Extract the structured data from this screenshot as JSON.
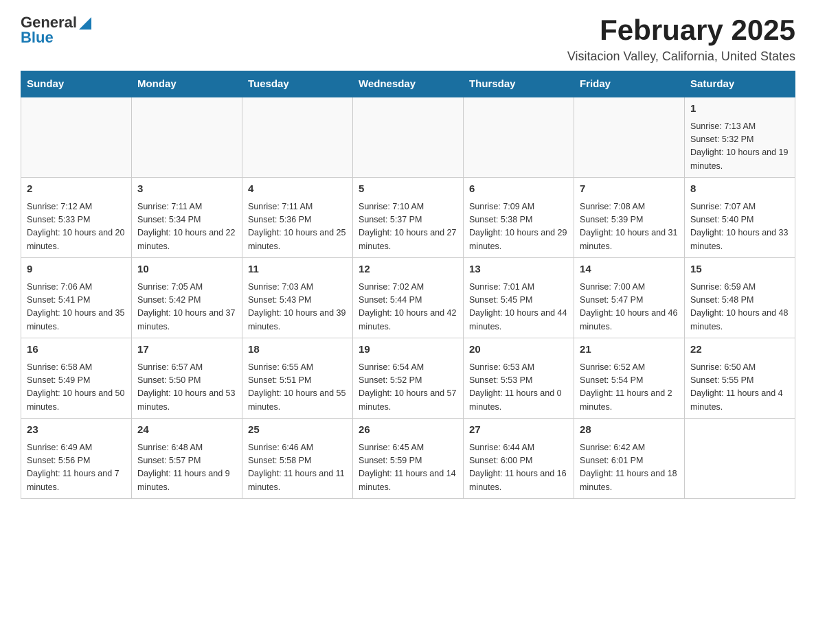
{
  "header": {
    "logo_general": "General",
    "logo_blue": "Blue",
    "month_title": "February 2025",
    "location": "Visitacion Valley, California, United States"
  },
  "calendar": {
    "days_of_week": [
      "Sunday",
      "Monday",
      "Tuesday",
      "Wednesday",
      "Thursday",
      "Friday",
      "Saturday"
    ],
    "weeks": [
      [
        {
          "day": "",
          "info": ""
        },
        {
          "day": "",
          "info": ""
        },
        {
          "day": "",
          "info": ""
        },
        {
          "day": "",
          "info": ""
        },
        {
          "day": "",
          "info": ""
        },
        {
          "day": "",
          "info": ""
        },
        {
          "day": "1",
          "info": "Sunrise: 7:13 AM\nSunset: 5:32 PM\nDaylight: 10 hours and 19 minutes."
        }
      ],
      [
        {
          "day": "2",
          "info": "Sunrise: 7:12 AM\nSunset: 5:33 PM\nDaylight: 10 hours and 20 minutes."
        },
        {
          "day": "3",
          "info": "Sunrise: 7:11 AM\nSunset: 5:34 PM\nDaylight: 10 hours and 22 minutes."
        },
        {
          "day": "4",
          "info": "Sunrise: 7:11 AM\nSunset: 5:36 PM\nDaylight: 10 hours and 25 minutes."
        },
        {
          "day": "5",
          "info": "Sunrise: 7:10 AM\nSunset: 5:37 PM\nDaylight: 10 hours and 27 minutes."
        },
        {
          "day": "6",
          "info": "Sunrise: 7:09 AM\nSunset: 5:38 PM\nDaylight: 10 hours and 29 minutes."
        },
        {
          "day": "7",
          "info": "Sunrise: 7:08 AM\nSunset: 5:39 PM\nDaylight: 10 hours and 31 minutes."
        },
        {
          "day": "8",
          "info": "Sunrise: 7:07 AM\nSunset: 5:40 PM\nDaylight: 10 hours and 33 minutes."
        }
      ],
      [
        {
          "day": "9",
          "info": "Sunrise: 7:06 AM\nSunset: 5:41 PM\nDaylight: 10 hours and 35 minutes."
        },
        {
          "day": "10",
          "info": "Sunrise: 7:05 AM\nSunset: 5:42 PM\nDaylight: 10 hours and 37 minutes."
        },
        {
          "day": "11",
          "info": "Sunrise: 7:03 AM\nSunset: 5:43 PM\nDaylight: 10 hours and 39 minutes."
        },
        {
          "day": "12",
          "info": "Sunrise: 7:02 AM\nSunset: 5:44 PM\nDaylight: 10 hours and 42 minutes."
        },
        {
          "day": "13",
          "info": "Sunrise: 7:01 AM\nSunset: 5:45 PM\nDaylight: 10 hours and 44 minutes."
        },
        {
          "day": "14",
          "info": "Sunrise: 7:00 AM\nSunset: 5:47 PM\nDaylight: 10 hours and 46 minutes."
        },
        {
          "day": "15",
          "info": "Sunrise: 6:59 AM\nSunset: 5:48 PM\nDaylight: 10 hours and 48 minutes."
        }
      ],
      [
        {
          "day": "16",
          "info": "Sunrise: 6:58 AM\nSunset: 5:49 PM\nDaylight: 10 hours and 50 minutes."
        },
        {
          "day": "17",
          "info": "Sunrise: 6:57 AM\nSunset: 5:50 PM\nDaylight: 10 hours and 53 minutes."
        },
        {
          "day": "18",
          "info": "Sunrise: 6:55 AM\nSunset: 5:51 PM\nDaylight: 10 hours and 55 minutes."
        },
        {
          "day": "19",
          "info": "Sunrise: 6:54 AM\nSunset: 5:52 PM\nDaylight: 10 hours and 57 minutes."
        },
        {
          "day": "20",
          "info": "Sunrise: 6:53 AM\nSunset: 5:53 PM\nDaylight: 11 hours and 0 minutes."
        },
        {
          "day": "21",
          "info": "Sunrise: 6:52 AM\nSunset: 5:54 PM\nDaylight: 11 hours and 2 minutes."
        },
        {
          "day": "22",
          "info": "Sunrise: 6:50 AM\nSunset: 5:55 PM\nDaylight: 11 hours and 4 minutes."
        }
      ],
      [
        {
          "day": "23",
          "info": "Sunrise: 6:49 AM\nSunset: 5:56 PM\nDaylight: 11 hours and 7 minutes."
        },
        {
          "day": "24",
          "info": "Sunrise: 6:48 AM\nSunset: 5:57 PM\nDaylight: 11 hours and 9 minutes."
        },
        {
          "day": "25",
          "info": "Sunrise: 6:46 AM\nSunset: 5:58 PM\nDaylight: 11 hours and 11 minutes."
        },
        {
          "day": "26",
          "info": "Sunrise: 6:45 AM\nSunset: 5:59 PM\nDaylight: 11 hours and 14 minutes."
        },
        {
          "day": "27",
          "info": "Sunrise: 6:44 AM\nSunset: 6:00 PM\nDaylight: 11 hours and 16 minutes."
        },
        {
          "day": "28",
          "info": "Sunrise: 6:42 AM\nSunset: 6:01 PM\nDaylight: 11 hours and 18 minutes."
        },
        {
          "day": "",
          "info": ""
        }
      ]
    ]
  }
}
